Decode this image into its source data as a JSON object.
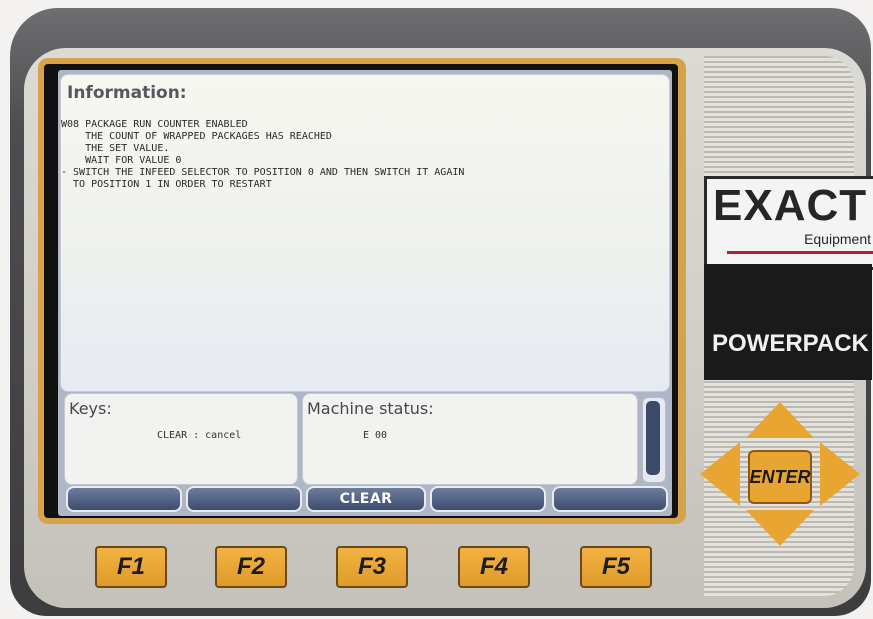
{
  "screen": {
    "info_title": "Information:",
    "message_lines": [
      "W08 PACKAGE RUN COUNTER ENABLED",
      "    THE COUNT OF WRAPPED PACKAGES HAS REACHED",
      "    THE SET VALUE.",
      "    WAIT FOR VALUE 0",
      "",
      "- SWITCH THE INFEED SELECTOR TO POSITION 0 AND THEN SWITCH IT AGAIN",
      "  TO POSITION 1 IN ORDER TO RESTART"
    ],
    "keys_title": "Keys:",
    "keys_text": "CLEAR : cancel",
    "status_title": "Machine status:",
    "status_text": "E 00",
    "softkeys": [
      "",
      "",
      "CLEAR",
      "",
      ""
    ]
  },
  "logo": {
    "brand": "EXACT",
    "sub": "Equipment",
    "product": "POWERPACK"
  },
  "keypad": {
    "enter_label": "ENTER",
    "function_keys": [
      "F1",
      "F2",
      "F3",
      "F4",
      "F5"
    ]
  },
  "colors": {
    "accent": "#e9a531",
    "screen_bg": "#f4f5ef",
    "softkey": "#4a5a7a"
  }
}
